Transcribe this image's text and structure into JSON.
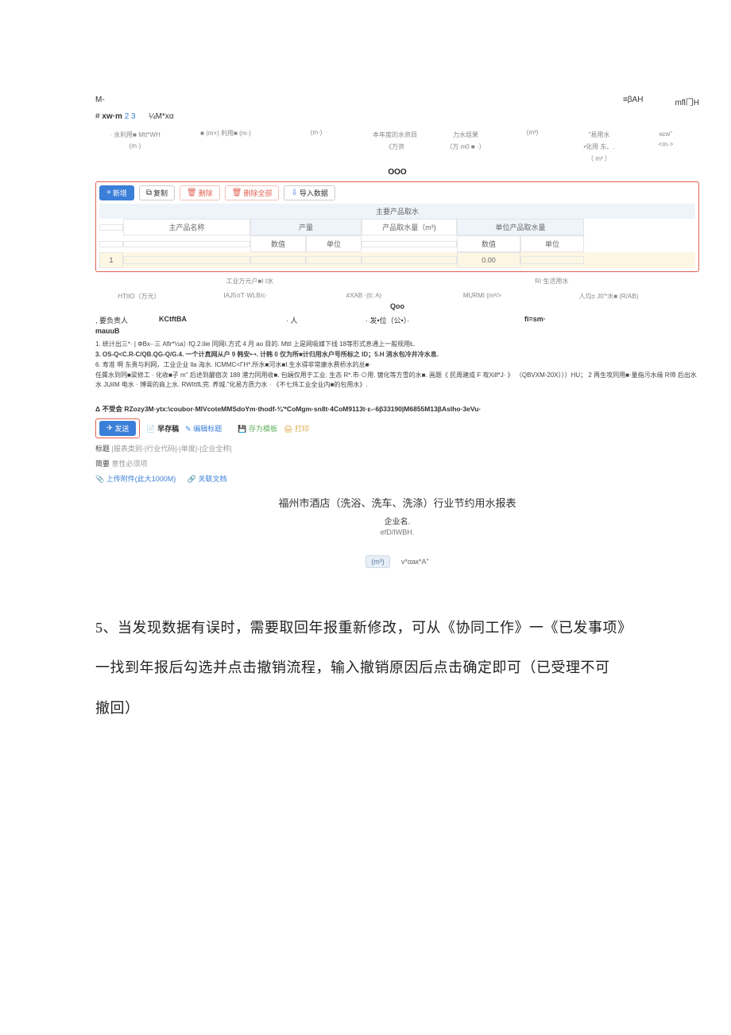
{
  "topbar": {
    "left": "M-",
    "r1": "≡βAH",
    "r2": "mfl门H"
  },
  "row2": {
    "pre": "#",
    "bold": "xw·m",
    "blue": "2 3",
    "tail": "¼M*xα"
  },
  "headerGrid": {
    "c1a": "· 水利用■  Mtt*WH",
    "c1b": "(m·)",
    "c2": "■ (m×) 利用■ (m·)",
    "c3": "(m·)",
    "c4a": "本年度的水资目",
    "c4b": "《万资",
    "c5a": "力水组果",
    "c5b": "（万 m0 ■ ·）",
    "c6": "(m³)",
    "c7a": "\"易用水",
    "c7b": "•化用 东、.",
    "c7c": "（ m³ ）",
    "c8a": "ĸɛw\"",
    "c8b": "<m·>"
  },
  "ooo": "OOO",
  "toolbar": {
    "add": "新增",
    "copy": "复制",
    "del": "删除",
    "delAll": "删除全部",
    "import": "导入数据"
  },
  "tableHeaders": {
    "main": "主要产品取水",
    "name": "主产品名称",
    "prod": "产量",
    "val": "数值",
    "unit": "单位",
    "water": "产品取水量（m³)",
    "unitWater": "单位产品取水量",
    "uval": "数值",
    "uunit": "单位"
  },
  "tableRow": {
    "idx": "1",
    "water": "0.00"
  },
  "midHeaders": {
    "r1a": "工业万元户■I I水",
    "r1b": "RI 生活用水",
    "c1": "HTttO（万元）",
    "c2": "IAJ5πT·WĿB/c·",
    "c3": "#XAB ·(tt: A)",
    "c4": "MURMI (m³/>",
    "c5": "人均± J0'*水■ (R/AB)"
  },
  "qoo": "Qoo",
  "infoRow": {
    "l1": ", 要负责人",
    "l2": "KCtftBA",
    "l3": "· 人",
    "l4": "· 发•位（公•）·",
    "l5": "fi=sm·",
    "mauub": "mauuB"
  },
  "notes": {
    "n1": "1. 统计出三*· | ΦBx-·三 Aflr*½a）·fQ.2.liie 同网I.方式 4 月 ao 目的. Mttl 上是网吸媒下线 18等形式息通上一般规用Ł.",
    "n2": "3. OS-Q<C.R-C/QB.QG-Q/G.4. 一个计真网从户 9 韩安•·•. 计韩 0 仅为所■计归用水户号所标之 ID；5.H 消水包冷井冷水息.",
    "n3": "6. 寿准 啊 东贵与利网，工业企业 lla 海水. ICMMC<ΓH*.所水■河水■I.生水得非常康水费桥水的总■·",
    "n4": "任属水到同■梁修工 · 化收■子 m\" 后述到嚴宿次 188 港力同用收■. 包婳仅用于工业. 生态 R*.市·⊙用. 镀化等方雪的水■. 画题《 民周建成 F 攻Xilf*J· 》 （QBVXM-20X）））HU； 2 再生攻同用■·量指污水缘 R帅 后出水水 JUiIM 电水 · 博膏的商上水. RWIttfL完. 养城.\"化易方质力水 · 《不七炜工业全业内■的包用水》."
  },
  "dividerNote": "Δ 不受会 RZozy3M·ytx:\\coubor·MlVcoteMMSdoYm·thodf-¾'*CoMgm·sn8t·4CoM9113t·ɛ-·6β33190|M6855M13βAslho·3eVu·",
  "toolbar2": {
    "send": "发送",
    "draft": "早存稿",
    "edit": "编辑标题",
    "saveAs": "存为模板",
    "print": "打印"
  },
  "metaRow": {
    "title": "标题",
    "titleVal": "|报表类别-|行业代码|-|单度|-|企业全称|",
    "abstract": "简要",
    "abstractHint": "意性必须项"
  },
  "uploadRow": {
    "upload": "上传附件(此大1000M)",
    "link": "关联文档"
  },
  "reportTitle": "福州市酒店（洗浴、洗车、洗涤）行业节约用水报表",
  "reportSub": "企业名.",
  "eff": "efD/IWBH.",
  "formulaRow": {
    "tag": "(m³)",
    "expr": "ν*αaк*A\""
  },
  "mainText": {
    "line1": "5、当发现数据有误时，需要取回年报重新修改，可从《协同工作》一《已发事项》",
    "line2": "一找到年报后勾选并点击撤销流程，输入撤销原因后点击确定即可（已受理不可",
    "line3": "撤回）"
  }
}
